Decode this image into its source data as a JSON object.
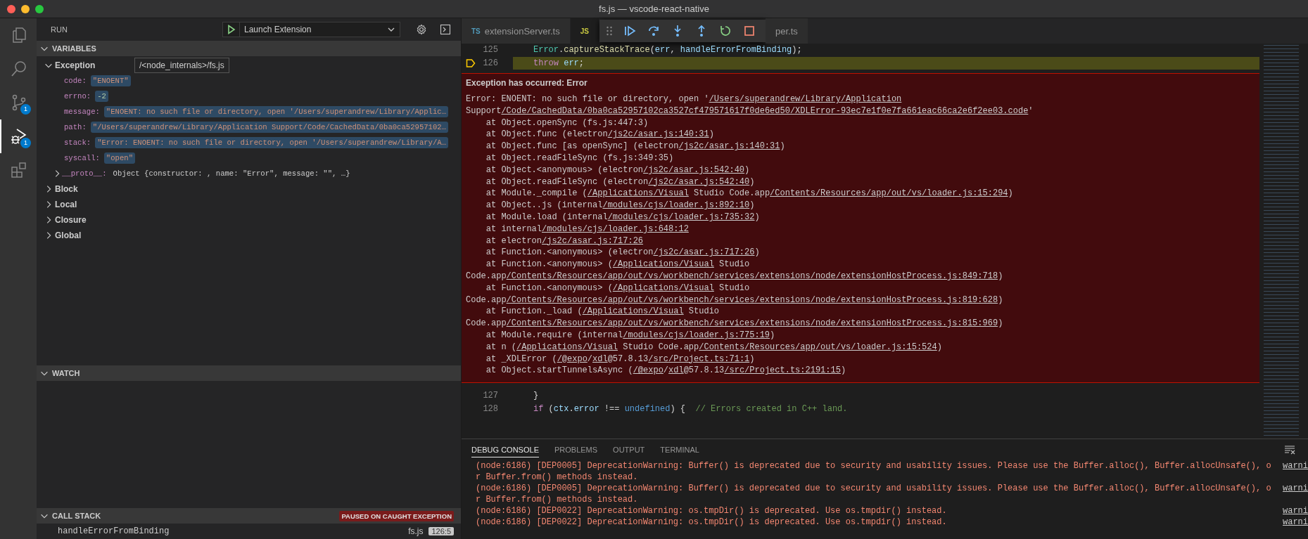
{
  "window": {
    "title": "fs.js — vscode-react-native"
  },
  "activity_bar": [
    {
      "kind": "files",
      "selected": false
    },
    {
      "kind": "search",
      "selected": false
    },
    {
      "kind": "source-control",
      "selected": false,
      "badge": "1"
    },
    {
      "kind": "debug",
      "selected": true,
      "badge": "1"
    },
    {
      "kind": "extensions",
      "selected": false
    }
  ],
  "sidebar": {
    "title": "RUN",
    "launch_config": "Launch Extension",
    "variables": {
      "title": "VARIABLES",
      "expanded": true,
      "tooltip": "/<node_internals>/fs.js",
      "scopes": [
        {
          "name": "Exception",
          "expanded": true,
          "children": [
            {
              "name": "code:",
              "value": "\"ENOENT\"",
              "kind": "string",
              "changed": true
            },
            {
              "name": "errno:",
              "value": "-2",
              "kind": "number",
              "changed": true
            },
            {
              "name": "message:",
              "value": "\"ENOENT: no such file or directory, open '/Users/superandrew/Library/Applic…",
              "kind": "string",
              "changed": true
            },
            {
              "name": "path:",
              "value": "\"/Users/superandrew/Library/Application Support/Code/CachedData/0ba0ca52957102…",
              "kind": "string",
              "changed": true
            },
            {
              "name": "stack:",
              "value": "\"Error: ENOENT: no such file or directory, open '/Users/superandrew/Library/A…",
              "kind": "string",
              "changed": true
            },
            {
              "name": "syscall:",
              "value": "\"open\"",
              "kind": "string",
              "changed": true
            },
            {
              "name": "__proto__:",
              "value": "Object {constructor: , name: \"Error\", message: \"\", …}",
              "kind": "object",
              "changed": false,
              "expanded": false
            }
          ]
        },
        {
          "name": "Block",
          "expanded": false
        },
        {
          "name": "Local",
          "expanded": false
        },
        {
          "name": "Closure",
          "expanded": false
        },
        {
          "name": "Global",
          "expanded": false
        }
      ]
    },
    "watch": {
      "title": "WATCH",
      "expanded": true
    },
    "call_stack": {
      "title": "CALL STACK",
      "expanded": true,
      "badge": "PAUSED ON CAUGHT EXCEPTION",
      "frames": [
        {
          "name": "handleErrorFromBinding",
          "file": "fs.js",
          "position": "126:5"
        }
      ]
    }
  },
  "editor": {
    "tabs": [
      {
        "kind": "typescript",
        "icon_text": "TS",
        "label": "extensionServer.ts",
        "selected": false
      },
      {
        "kind": "javascript",
        "icon_text": "JS",
        "selected": true
      },
      {
        "label": "per.ts",
        "selected": false
      }
    ],
    "debug_toolbar": [
      {
        "kind": "continue"
      },
      {
        "kind": "step-over"
      },
      {
        "kind": "step-into"
      },
      {
        "kind": "step-out"
      },
      {
        "kind": "restart"
      },
      {
        "kind": "stop"
      }
    ],
    "lines_before": [
      {
        "number": "125",
        "current": false,
        "tokens": [
          {
            "text": "Error",
            "kind": "class"
          },
          {
            "text": ".",
            "kind": "plain"
          },
          {
            "text": "captureStackTrace",
            "kind": "function"
          },
          {
            "text": "(",
            "kind": "plain"
          },
          {
            "text": "err",
            "kind": "variable"
          },
          {
            "text": ", ",
            "kind": "plain"
          },
          {
            "text": "handleErrorFromBinding",
            "kind": "variable"
          },
          {
            "text": ");",
            "kind": "plain"
          }
        ]
      },
      {
        "number": "126",
        "current": true,
        "tokens": [
          {
            "text": "throw",
            "kind": "keyword"
          },
          {
            "text": " err",
            "kind": "variable"
          },
          {
            "text": ";",
            "kind": "plain"
          }
        ]
      }
    ],
    "exception": {
      "title": "Exception has occurred: Error",
      "lines": [
        {
          "indented": false,
          "segments": [
            {
              "text": "Error: ENOENT: no such file or directory, open '",
              "link": false
            },
            {
              "text": "/Users/superandrew/Library/Application",
              "link": true
            }
          ]
        },
        {
          "indented": false,
          "segments": [
            {
              "text": "Support",
              "link": false
            },
            {
              "text": "/Code/CachedData/0ba0ca52957102ca3527cf479571617f0de6ed50/XDLError-93ec7e1f0e7fa661eac66ca2e6f2ee03.code",
              "link": true
            },
            {
              "text": "'",
              "link": false
            }
          ]
        },
        {
          "indented": true,
          "segments": [
            {
              "text": "at Object.openSync (fs.js:447:3)",
              "link": false
            }
          ]
        },
        {
          "indented": true,
          "segments": [
            {
              "text": "at Object.func (electron",
              "link": false
            },
            {
              "text": "/js2c/asar.js:140:31",
              "link": true
            },
            {
              "text": ")",
              "link": false
            }
          ]
        },
        {
          "indented": true,
          "segments": [
            {
              "text": "at Object.func [as openSync] (electron",
              "link": false
            },
            {
              "text": "/js2c/asar.js:140:31",
              "link": true
            },
            {
              "text": ")",
              "link": false
            }
          ]
        },
        {
          "indented": true,
          "segments": [
            {
              "text": "at Object.readFileSync (fs.js:349:35)",
              "link": false
            }
          ]
        },
        {
          "indented": true,
          "segments": [
            {
              "text": "at Object.<anonymous> (electron",
              "link": false
            },
            {
              "text": "/js2c/asar.js:542:40",
              "link": true
            },
            {
              "text": ")",
              "link": false
            }
          ]
        },
        {
          "indented": true,
          "segments": [
            {
              "text": "at Object.readFileSync (electron",
              "link": false
            },
            {
              "text": "/js2c/asar.js:542:40",
              "link": true
            },
            {
              "text": ")",
              "link": false
            }
          ]
        },
        {
          "indented": true,
          "segments": [
            {
              "text": "at Module._compile (",
              "link": false
            },
            {
              "text": "/Applications/Visual",
              "link": true
            },
            {
              "text": " Studio Code.app",
              "link": false
            },
            {
              "text": "/Contents/Resources/app/out/vs/loader.js:15:294",
              "link": true
            },
            {
              "text": ")",
              "link": false
            }
          ]
        },
        {
          "indented": true,
          "segments": [
            {
              "text": "at Object..js (internal",
              "link": false
            },
            {
              "text": "/modules/cjs/loader.js:892:10",
              "link": true
            },
            {
              "text": ")",
              "link": false
            }
          ]
        },
        {
          "indented": true,
          "segments": [
            {
              "text": "at Module.load (internal",
              "link": false
            },
            {
              "text": "/modules/cjs/loader.js:735:32",
              "link": true
            },
            {
              "text": ")",
              "link": false
            }
          ]
        },
        {
          "indented": true,
          "segments": [
            {
              "text": "at internal",
              "link": false
            },
            {
              "text": "/modules/cjs/loader.js:648:12",
              "link": true
            }
          ]
        },
        {
          "indented": true,
          "segments": [
            {
              "text": "at electron",
              "link": false
            },
            {
              "text": "/js2c/asar.js:717:26",
              "link": true
            }
          ]
        },
        {
          "indented": true,
          "segments": [
            {
              "text": "at Function.<anonymous> (electron",
              "link": false
            },
            {
              "text": "/js2c/asar.js:717:26",
              "link": true
            },
            {
              "text": ")",
              "link": false
            }
          ]
        },
        {
          "indented": true,
          "segments": [
            {
              "text": "at Function.<anonymous> (",
              "link": false
            },
            {
              "text": "/Applications/Visual",
              "link": true
            },
            {
              "text": " Studio",
              "link": false
            }
          ]
        },
        {
          "indented": false,
          "segments": [
            {
              "text": "Code.app",
              "link": false
            },
            {
              "text": "/Contents/Resources/app/out/vs/workbench/services/extensions/node/extensionHostProcess.js:849:718",
              "link": true
            },
            {
              "text": ")",
              "link": false
            }
          ]
        },
        {
          "indented": true,
          "segments": [
            {
              "text": "at Function.<anonymous> (",
              "link": false
            },
            {
              "text": "/Applications/Visual",
              "link": true
            },
            {
              "text": " Studio",
              "link": false
            }
          ]
        },
        {
          "indented": false,
          "segments": [
            {
              "text": "Code.app",
              "link": false
            },
            {
              "text": "/Contents/Resources/app/out/vs/workbench/services/extensions/node/extensionHostProcess.js:819:628",
              "link": true
            },
            {
              "text": ")",
              "link": false
            }
          ]
        },
        {
          "indented": true,
          "segments": [
            {
              "text": "at Function._load (",
              "link": false
            },
            {
              "text": "/Applications/Visual",
              "link": true
            },
            {
              "text": " Studio",
              "link": false
            }
          ]
        },
        {
          "indented": false,
          "segments": [
            {
              "text": "Code.app",
              "link": false
            },
            {
              "text": "/Contents/Resources/app/out/vs/workbench/services/extensions/node/extensionHostProcess.js:815:969",
              "link": true
            },
            {
              "text": ")",
              "link": false
            }
          ]
        },
        {
          "indented": true,
          "segments": [
            {
              "text": "at Module.require (internal",
              "link": false
            },
            {
              "text": "/modules/cjs/loader.js:775:19",
              "link": true
            },
            {
              "text": ")",
              "link": false
            }
          ]
        },
        {
          "indented": true,
          "segments": [
            {
              "text": "at n (",
              "link": false
            },
            {
              "text": "/Applications/Visual",
              "link": true
            },
            {
              "text": " Studio Code.app",
              "link": false
            },
            {
              "text": "/Contents/Resources/app/out/vs/loader.js:15:524",
              "link": true
            },
            {
              "text": ")",
              "link": false
            }
          ]
        },
        {
          "indented": true,
          "segments": [
            {
              "text": "at _XDLError (",
              "link": false
            },
            {
              "text": "/@expo",
              "link": true
            },
            {
              "text": "/",
              "link": false
            },
            {
              "text": "xdl",
              "link": true
            },
            {
              "text": "@57.8.13",
              "link": false
            },
            {
              "text": "/src/Project.ts:71:1",
              "link": true
            },
            {
              "text": ")",
              "link": false
            }
          ]
        },
        {
          "indented": true,
          "segments": [
            {
              "text": "at Object.startTunnelsAsync (",
              "link": false
            },
            {
              "text": "/@expo",
              "link": true
            },
            {
              "text": "/",
              "link": false
            },
            {
              "text": "xdl",
              "link": true
            },
            {
              "text": "@57.8.13",
              "link": false
            },
            {
              "text": "/src/Project.ts:2191:15",
              "link": true
            },
            {
              "text": ")",
              "link": false
            }
          ]
        }
      ]
    },
    "lines_after": [
      {
        "number": "127",
        "current": false,
        "tokens": [
          {
            "text": "}",
            "kind": "plain"
          }
        ]
      },
      {
        "number": "128",
        "current": false,
        "tokens": [
          {
            "text": "if",
            "kind": "keyword"
          },
          {
            "text": " (",
            "kind": "plain"
          },
          {
            "text": "ctx",
            "kind": "variable"
          },
          {
            "text": ".",
            "kind": "plain"
          },
          {
            "text": "error",
            "kind": "variable"
          },
          {
            "text": " !== ",
            "kind": "plain"
          },
          {
            "text": "undefined",
            "kind": "constant"
          },
          {
            "text": ") {  ",
            "kind": "plain"
          },
          {
            "text": "// Errors created in C++ land.",
            "kind": "comment"
          }
        ]
      }
    ]
  },
  "panel": {
    "tabs": [
      {
        "label": "DEBUG CONSOLE",
        "selected": true
      },
      {
        "label": "PROBLEMS",
        "selected": false
      },
      {
        "label": "OUTPUT",
        "selected": false
      },
      {
        "label": "TERMINAL",
        "selected": false
      }
    ],
    "entries": [
      {
        "message": "(node:6186) [DEP0005] DeprecationWarning: Buffer() is deprecated due to security and usability issues. Please use the Buffer.alloc(), Buffer.allocUnsafe(), or Buffer.from() methods instead.",
        "source": "warni"
      },
      {
        "message": "(node:6186) [DEP0005] DeprecationWarning: Buffer() is deprecated due to security and usability issues. Please use the Buffer.alloc(), Buffer.allocUnsafe(), or Buffer.from() methods instead.",
        "source": "warni"
      },
      {
        "message": "(node:6186) [DEP0022] DeprecationWarning: os.tmpDir() is deprecated. Use os.tmpdir() instead.",
        "source": "warni"
      },
      {
        "message": "(node:6186) [DEP0022] DeprecationWarning: os.tmpDir() is deprecated. Use os.tmpdir() instead.",
        "source": "warni"
      }
    ]
  }
}
